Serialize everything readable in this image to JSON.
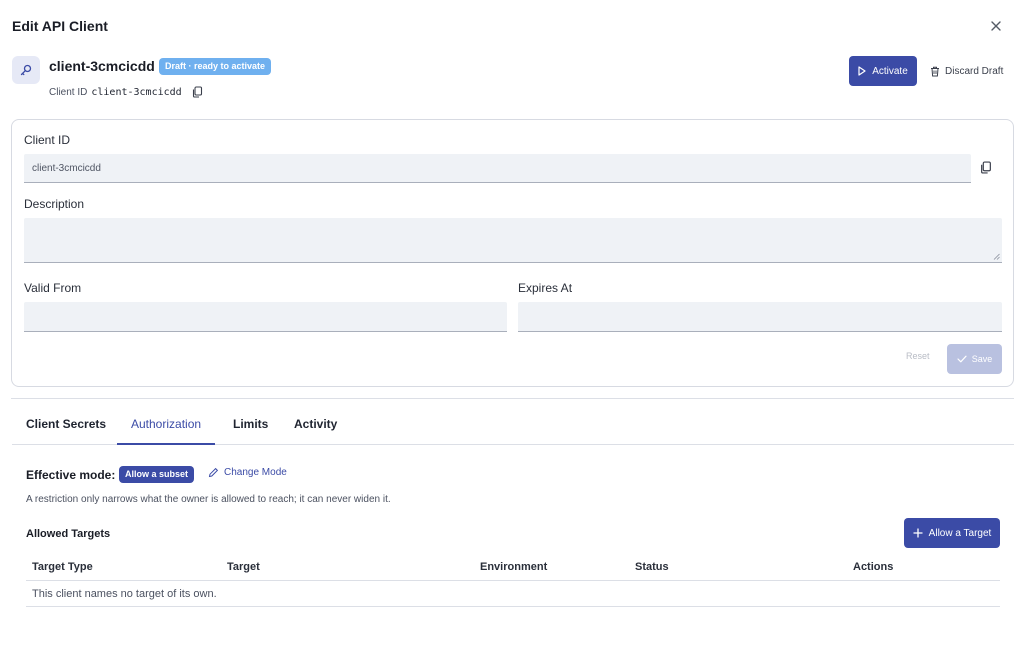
{
  "dialog": {
    "title": "Edit API Client"
  },
  "client": {
    "name": "client-3cmcicdd",
    "status_badge": "Draft · ready to activate",
    "id_label": "Client ID",
    "id_value": "client-3cmcicdd"
  },
  "actions": {
    "activate_label": "Activate",
    "discard_label": "Discard Draft"
  },
  "form": {
    "client_id_label": "Client ID",
    "client_id_value": "client-3cmcicdd",
    "description_label": "Description",
    "description_value": "",
    "valid_from_label": "Valid From",
    "valid_from_value": "",
    "expires_at_label": "Expires At",
    "expires_at_value": "",
    "reset_label": "Reset",
    "save_label": "Save"
  },
  "tabs": [
    {
      "label": "Client Secrets"
    },
    {
      "label": "Authorization"
    },
    {
      "label": "Limits"
    },
    {
      "label": "Activity"
    }
  ],
  "active_tab": "Authorization",
  "authorization": {
    "mode_label": "Effective mode:",
    "mode_value": "Allow a subset",
    "change_mode_label": "Change Mode",
    "note": "A restriction only narrows what the owner is allowed to reach; it can never widen it.",
    "targets_title": "Allowed Targets",
    "allow_target_label": "Allow a Target",
    "table": {
      "columns": [
        "Target Type",
        "Target",
        "Environment",
        "Status",
        "Actions"
      ],
      "empty_message": "This client names no target of its own."
    }
  },
  "colors": {
    "accent": "#3b4ba6",
    "badge_draft": "#6fb0ef",
    "save_disabled": "#b9c1e0"
  },
  "icons": [
    "key-icon",
    "close-icon",
    "copy-icon",
    "play-icon",
    "trash-icon",
    "pencil-icon",
    "plus-icon",
    "check-icon"
  ]
}
